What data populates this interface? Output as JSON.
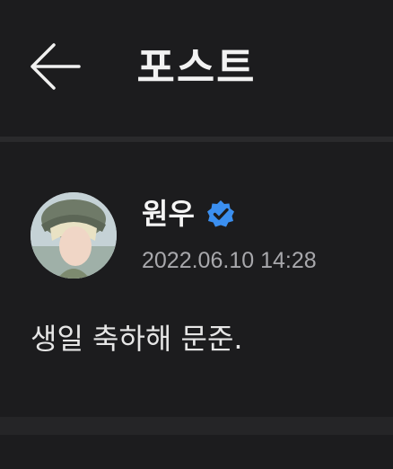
{
  "header": {
    "title": "포스트",
    "back_icon": "arrow-left-icon"
  },
  "post": {
    "author": "원우",
    "verified_icon": "verified-badge-icon",
    "timestamp": "2022.06.10 14:28",
    "text": "생일 축하해 문준."
  },
  "colors": {
    "background": "#1c1c1e",
    "verified": "#3b8ff0",
    "muted_text": "#a8a8ac"
  }
}
